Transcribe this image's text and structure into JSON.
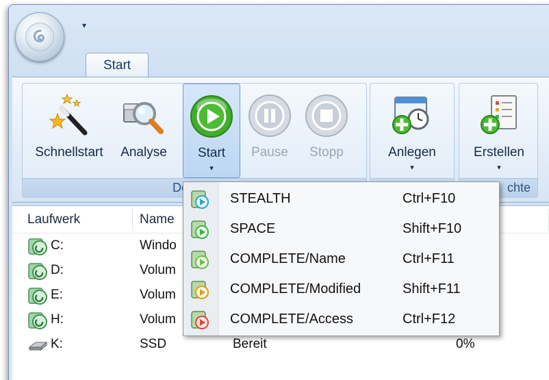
{
  "qat": {
    "menu_arrow": "▾"
  },
  "tabs": [
    {
      "label": "Start"
    }
  ],
  "ribbon": {
    "groups": [
      {
        "label": "Defragmentieren"
      },
      {
        "label": ""
      },
      {
        "label": "...chte"
      }
    ],
    "buttons": {
      "schnellstart": {
        "label": "Schnellstart",
        "icon": "magic-wand-icon"
      },
      "analyse": {
        "label": "Analyse",
        "icon": "magnifier-icon"
      },
      "start": {
        "label": "Start",
        "icon": "play-icon",
        "dropdown": "▾"
      },
      "pause": {
        "label": "Pause",
        "icon": "pause-icon"
      },
      "stopp": {
        "label": "Stopp",
        "icon": "stop-icon"
      },
      "anlegen": {
        "label": "Anlegen",
        "icon": "schedule-add-icon",
        "dropdown": "▾"
      },
      "erstellen": {
        "label": "Erstellen",
        "icon": "report-add-icon",
        "dropdown": "▾"
      }
    },
    "group_labels_visible": {
      "defrag": "Defragn",
      "reports": "chte"
    }
  },
  "list": {
    "headers": {
      "drive": "Laufwerk",
      "name": "Name"
    },
    "rows": [
      {
        "drive": "C:",
        "name": "Windo",
        "status": "",
        "percent": ""
      },
      {
        "drive": "D:",
        "name": "Volum",
        "status": "",
        "percent": ""
      },
      {
        "drive": "E:",
        "name": "Volum",
        "status": "",
        "percent": ""
      },
      {
        "drive": "H:",
        "name": "Volum",
        "status": "",
        "percent": ""
      },
      {
        "drive": "K:",
        "name": "SSD",
        "status": "Bereit",
        "percent": "0%"
      }
    ]
  },
  "menu": {
    "items": [
      {
        "label": "STEALTH",
        "shortcut": "Ctrl+F10",
        "accent": "#29a7c9"
      },
      {
        "label": "SPACE",
        "shortcut": "Shift+F10",
        "accent": "#3cb54a"
      },
      {
        "label": "COMPLETE/Name",
        "shortcut": "Ctrl+F11",
        "accent": "#6cc04a"
      },
      {
        "label": "COMPLETE/Modified",
        "shortcut": "Shift+F11",
        "accent": "#d9a21b"
      },
      {
        "label": "COMPLETE/Access",
        "shortcut": "Ctrl+F12",
        "accent": "#e0473c"
      }
    ]
  },
  "colors": {
    "ribbon_blue": "#dbe8f6",
    "play_green": "#3fae2a",
    "disabled_gray": "#9aa6b4"
  }
}
